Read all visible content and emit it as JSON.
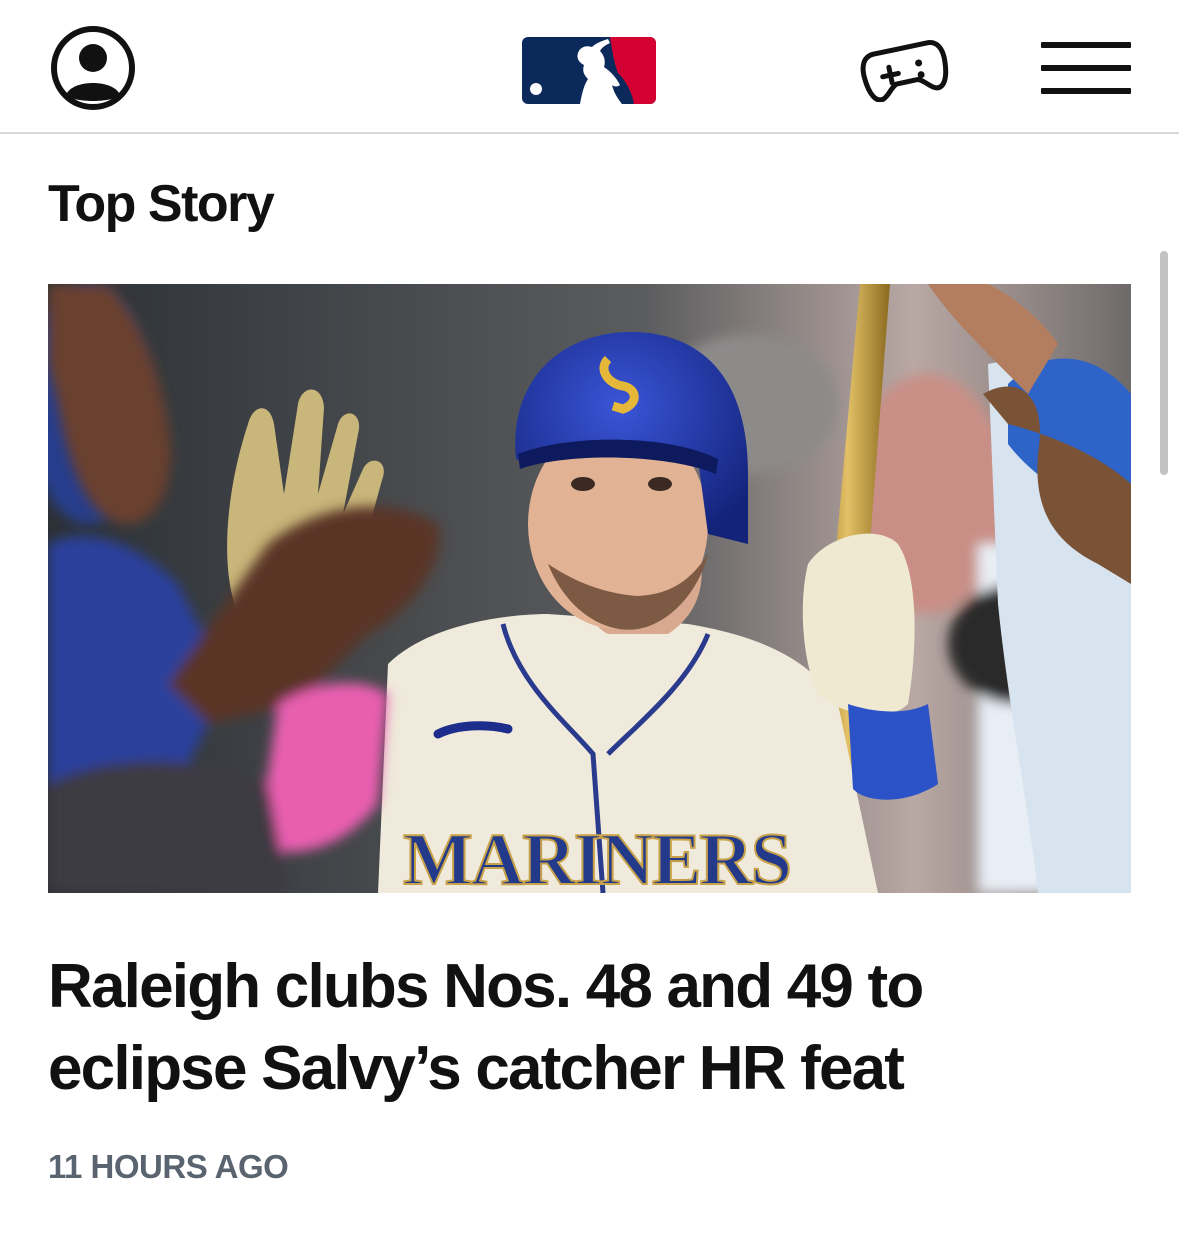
{
  "header": {
    "account_icon": "user-circle-icon",
    "logo_icon": "mlb-logo",
    "game_icon": "gamepad-icon",
    "menu_icon": "hamburger-menu-icon"
  },
  "colors": {
    "mlb_blue": "#0b2a5b",
    "mlb_red": "#d50032",
    "timestamp_gray": "#5a6470"
  },
  "section": {
    "title": "Top Story"
  },
  "story": {
    "image_jersey_text": "MARINERS",
    "headline": "Raleigh clubs Nos. 48 and 49 to eclipse Salvy’s catcher HR feat",
    "timestamp": "11 HOURS AGO"
  }
}
